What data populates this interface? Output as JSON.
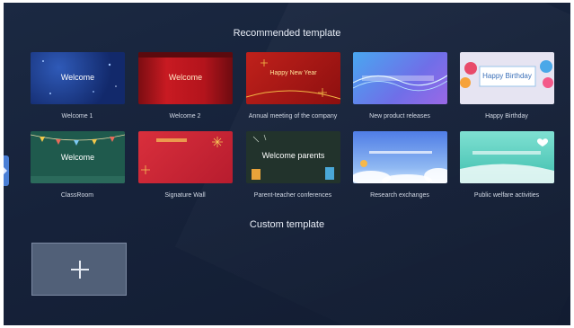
{
  "recommended": {
    "title": "Recommended template",
    "templates": [
      {
        "label": "Welcome 1",
        "thumb_text": "Welcome"
      },
      {
        "label": "Welcome 2",
        "thumb_text": "Welcome"
      },
      {
        "label": "Annual meeting of the company",
        "thumb_text": "Happy New Year"
      },
      {
        "label": "New product releases",
        "thumb_text": ""
      },
      {
        "label": "Happy Birthday",
        "thumb_text": "Happy Birthday"
      },
      {
        "label": "ClassRoom",
        "thumb_text": "Welcome"
      },
      {
        "label": "Signature Wall",
        "thumb_text": ""
      },
      {
        "label": "Parent-teacher conferences",
        "thumb_text": "Welcome parents"
      },
      {
        "label": "Research exchanges",
        "thumb_text": ""
      },
      {
        "label": "Public welfare activities",
        "thumb_text": ""
      }
    ]
  },
  "custom": {
    "title": "Custom template"
  },
  "colors": {
    "background": "#16223a",
    "accent": "#4a7fd6"
  }
}
